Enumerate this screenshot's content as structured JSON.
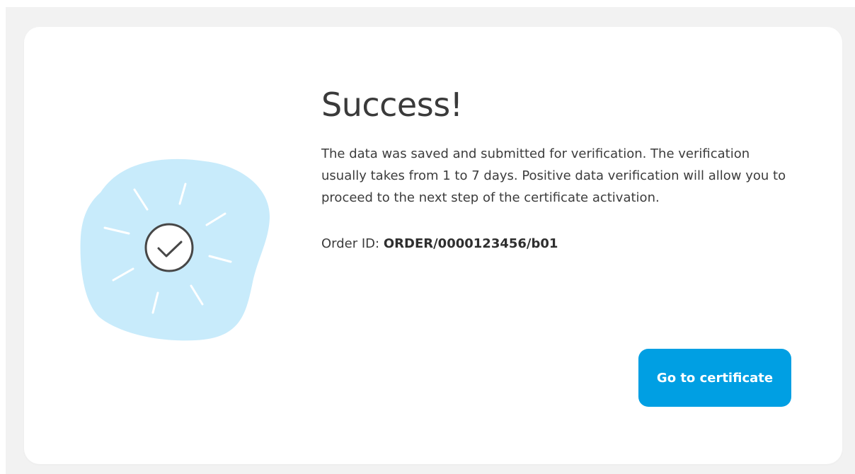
{
  "success_panel": {
    "title": "Success!",
    "message": "The data was saved and submitted for verification. The verification usually takes from 1 to 7 days. Positive data verification will allow you to proceed to the next step of the certificate activation.",
    "order_label": "Order ID:",
    "order_id": "ORDER/0000123456/b01",
    "cta_label": "Go to certificate",
    "illustration_icon": "check-circle-icon"
  },
  "colors": {
    "page_background": "#f2f2f2",
    "card_background": "#ffffff",
    "blob": "#c8ebfb",
    "accent": "#009fe3",
    "text": "#3c3c3c",
    "icon_stroke": "#474747"
  }
}
